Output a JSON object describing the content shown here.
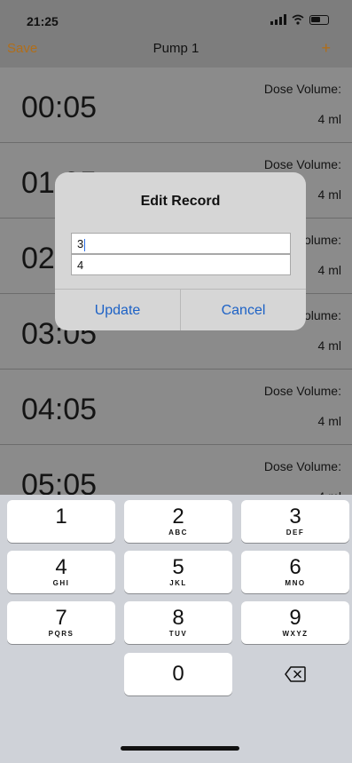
{
  "status_bar": {
    "time": "21:25"
  },
  "nav": {
    "save_label": "Save",
    "title": "Pump 1",
    "add_label": "+"
  },
  "records": [
    {
      "time": "00:05",
      "label": "Dose Volume:",
      "value": "4 ml"
    },
    {
      "time": "01:05",
      "label": "Dose Volume:",
      "value": "4 ml"
    },
    {
      "time": "02:05",
      "label": "Dose Volume:",
      "value": "4 ml"
    },
    {
      "time": "03:05",
      "label": "Dose Volume:",
      "value": "4 ml"
    },
    {
      "time": "04:05",
      "label": "Dose Volume:",
      "value": "4 ml"
    },
    {
      "time": "05:05",
      "label": "Dose Volume:",
      "value": "4 ml"
    }
  ],
  "dialog": {
    "title": "Edit Record",
    "field1_value": "3",
    "field2_value": "4",
    "update_label": "Update",
    "cancel_label": "Cancel"
  },
  "keypad": {
    "keys": [
      {
        "digit": "1",
        "letters": ""
      },
      {
        "digit": "2",
        "letters": "ABC"
      },
      {
        "digit": "3",
        "letters": "DEF"
      },
      {
        "digit": "4",
        "letters": "GHI"
      },
      {
        "digit": "5",
        "letters": "JKL"
      },
      {
        "digit": "6",
        "letters": "MNO"
      },
      {
        "digit": "7",
        "letters": "PQRS"
      },
      {
        "digit": "8",
        "letters": "TUV"
      },
      {
        "digit": "9",
        "letters": "WXYZ"
      },
      {
        "digit": "0",
        "letters": ""
      }
    ],
    "delete_icon": "delete-backspace-icon"
  },
  "colors": {
    "accent": "#b06e1a",
    "link": "#1d62c6"
  }
}
